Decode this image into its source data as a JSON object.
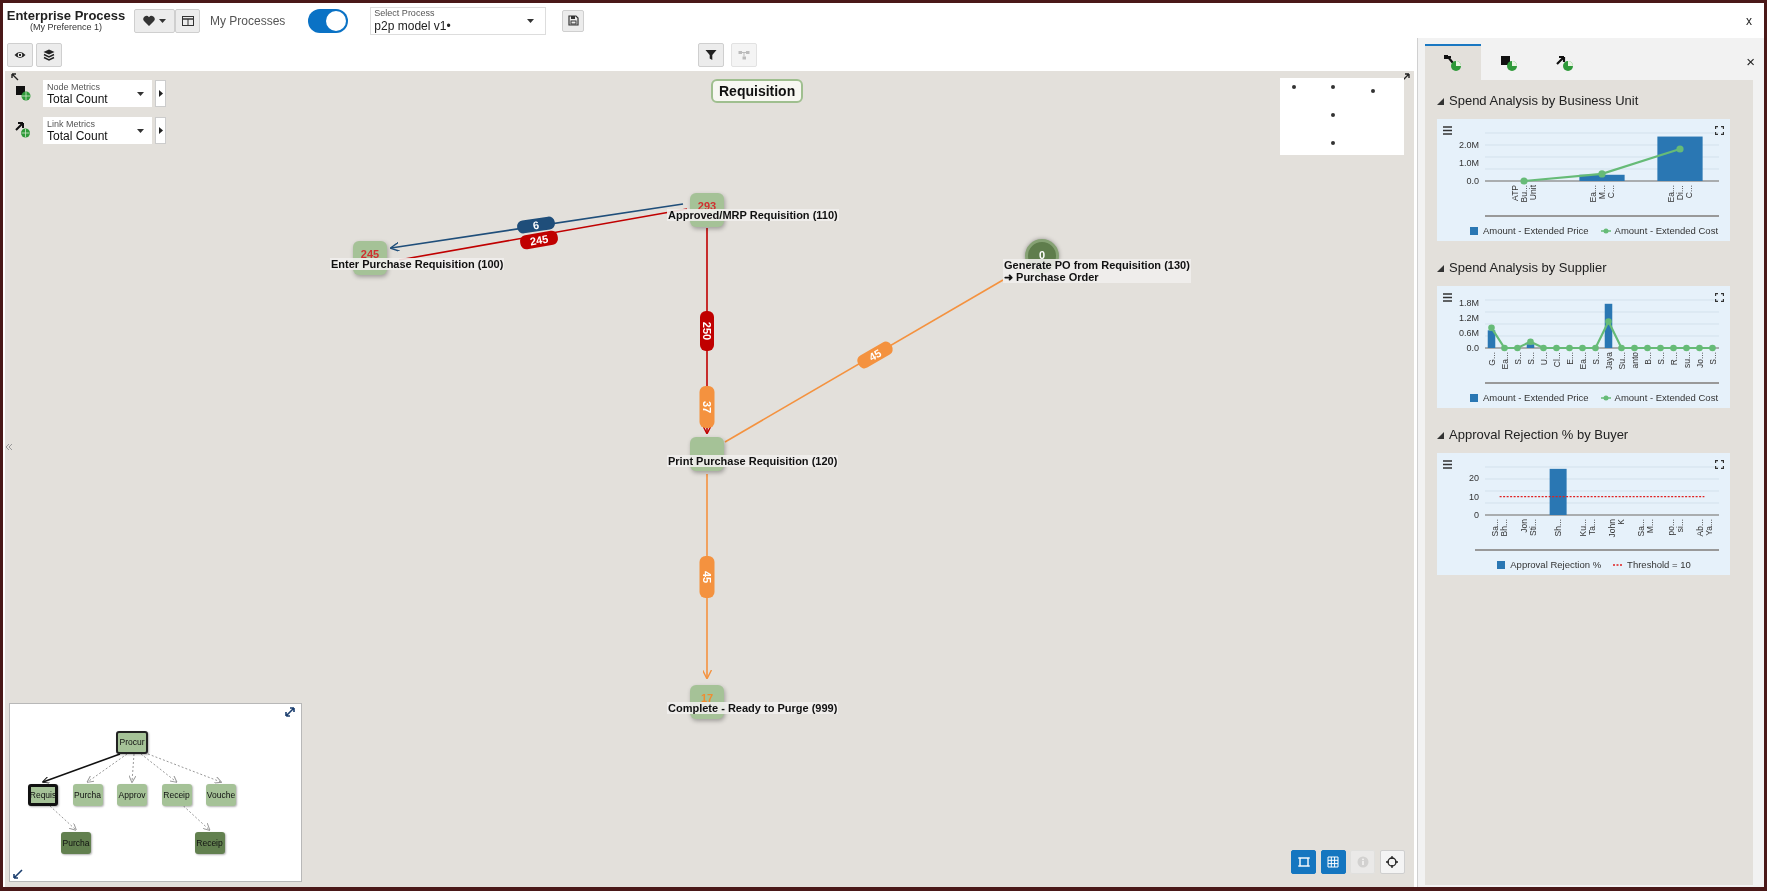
{
  "header": {
    "title": "Enterprise Process",
    "subtitle": "(My Preference 1)",
    "my_processes": {
      "label": "My Processes",
      "on": true
    },
    "select_process": {
      "label": "Select Process",
      "value": "p2p model v1•"
    },
    "close": "x"
  },
  "canvas": {
    "title": "Requisition",
    "node_metrics": {
      "label": "Node Metrics",
      "value": "Total Count"
    },
    "link_metrics": {
      "label": "Link Metrics",
      "value": "Total Count"
    },
    "nodes": [
      {
        "kind": "square",
        "label": "Approved/MRP Requisition (110)",
        "count": "293",
        "color": "#d03030"
      },
      {
        "kind": "square",
        "label": "Enter Purchase Requisition (100)",
        "count": "245",
        "color": "#d03030"
      },
      {
        "kind": "circle",
        "label": "Generate PO from Requisition (130)\n➜ Purchase Order",
        "count": "0",
        "color": "#ffffff"
      },
      {
        "kind": "square",
        "label": "Print Purchase Requisition (120)"
      },
      {
        "kind": "square",
        "label": "Complete - Ready to Purge (999)",
        "count": "17",
        "color": "#f08c30"
      }
    ],
    "edges": [
      {
        "label": "6",
        "color": "#1f4e7a"
      },
      {
        "label": "245",
        "color": "#c00000"
      },
      {
        "label": "250",
        "color": "#c00000"
      },
      {
        "label": "45",
        "color": "#f4923f"
      },
      {
        "label": "37",
        "color": "#f4923f"
      },
      {
        "label": "45",
        "color": "#f4923f"
      }
    ],
    "tree": {
      "label": "Procur",
      "selected": false,
      "children": [
        {
          "label": "Requis",
          "selected": true,
          "children": [
            {
              "label": "Purcha",
              "selected": false
            }
          ]
        },
        {
          "label": "Purcha",
          "selected": false
        },
        {
          "label": "Approv",
          "selected": false
        },
        {
          "label": "Receip",
          "selected": false,
          "children": [
            {
              "label": "Receip",
              "selected": false
            }
          ]
        },
        {
          "label": "Vouche",
          "selected": false
        }
      ]
    },
    "view_controls": [
      {
        "active": true,
        "disabled": false
      },
      {
        "active": true,
        "disabled": false
      },
      {
        "active": false,
        "disabled": true
      },
      {
        "active": false,
        "disabled": false
      }
    ]
  },
  "right_panel": {
    "tabs": [
      {
        "selected": true
      },
      {
        "selected": false
      },
      {
        "selected": false
      }
    ],
    "close": "×",
    "sections": [
      {
        "expanded": true,
        "chart_data": {
          "type": "bar",
          "title": "Spend Analysis by Business Unit",
          "categories": [
            "ATP\nBu...\nUnit",
            "Ea...\nM...\nC...",
            "Ea...\nDi...\nC..."
          ],
          "series": [
            {
              "name": "Amount - Extended Price",
              "type": "bar",
              "color": "#2a77b3",
              "values": [
                0,
                0.35,
                2.5
              ]
            },
            {
              "name": "Amount - Extended Cost",
              "type": "line",
              "marker": "circle",
              "color": "#66bb77",
              "values": [
                0,
                0.4,
                1.8
              ]
            }
          ],
          "legend": true,
          "ylim": [
            0,
            2.7
          ],
          "yticks": [
            {
              "value": 0,
              "label": "0.0"
            },
            {
              "value": 1,
              "label": "1.0M"
            },
            {
              "value": 2,
              "label": "2.0M"
            }
          ]
        }
      },
      {
        "expanded": true,
        "chart_data": {
          "type": "bar",
          "title": "Spend Analysis by Supplier",
          "categories": [
            "G...",
            "Ea...",
            "S...",
            "S...",
            "U...",
            "Cl...",
            "E...",
            "Ea...",
            "S...",
            "Jaya",
            "Su...",
            "anto",
            "B...",
            "S...",
            "R...",
            "su...",
            "Jo...",
            "S..."
          ],
          "series": [
            {
              "name": "Amount - Extended Price",
              "type": "bar",
              "color": "#2a77b3",
              "values": [
                0.7,
                0,
                0,
                0.15,
                0,
                0,
                0,
                0,
                0,
                1.75,
                0,
                0,
                0,
                0,
                0,
                0,
                0,
                0
              ]
            },
            {
              "name": "Amount - Extended Cost",
              "type": "line",
              "marker": "circle",
              "color": "#66bb77",
              "values": [
                0.8,
                0,
                0,
                0.25,
                0,
                0,
                0,
                0,
                0,
                1.05,
                0,
                0,
                0,
                0,
                0,
                0,
                0,
                0
              ]
            }
          ],
          "legend": true,
          "ylim": [
            0,
            1.9
          ],
          "yticks": [
            {
              "value": 0,
              "label": "0.0"
            },
            {
              "value": 0.6,
              "label": "0.6M"
            },
            {
              "value": 1.2,
              "label": "1.2M"
            },
            {
              "value": 1.8,
              "label": "1.8M"
            }
          ]
        }
      },
      {
        "expanded": true,
        "chart_data": {
          "type": "bar",
          "title": "Approval Rejection % by Buyer",
          "categories": [
            "Sa...\nBh...",
            "Jon\nSti...",
            "Sh...",
            "Ku...\nTa...",
            "John\nK",
            "Sa...\nM...",
            "po...\nsi...",
            "Ab...\nYa..."
          ],
          "series": [
            {
              "name": "Approval Rejection %",
              "type": "bar",
              "color": "#2a77b3",
              "values": [
                0,
                0,
                25,
                0,
                0,
                0,
                0,
                0
              ]
            },
            {
              "name": "Threshold = 10",
              "type": "line",
              "line_style": "dashed",
              "color": "#e02020",
              "values": [
                10,
                10,
                10,
                10,
                10,
                10,
                10,
                10
              ]
            }
          ],
          "legend": true,
          "ylim": [
            0,
            26
          ],
          "yticks": [
            {
              "value": 0,
              "label": "0"
            },
            {
              "value": 10,
              "label": "10"
            },
            {
              "value": 20,
              "label": "20"
            }
          ]
        }
      }
    ]
  }
}
